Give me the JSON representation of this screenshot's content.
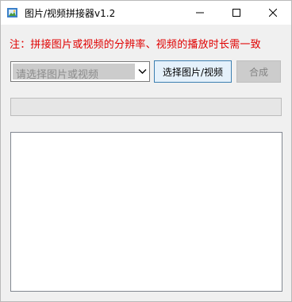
{
  "window": {
    "title": "图片/视频拼接器v1.2",
    "icon": "app-icon"
  },
  "note": "注：拼接图片或视频的分辨率、视频的播放时长需一致",
  "selector": {
    "placeholder": "请选择图片或视频",
    "icon": "chevron-down-icon"
  },
  "buttons": {
    "pick": "选择图片/视频",
    "compose": "合成"
  },
  "progress": {
    "value": 0
  },
  "colors": {
    "note": "#e00000",
    "pick_button_border": "#3c7fb1",
    "pick_button_bg": "#e5f1fb",
    "disabled_bg": "#cccccc"
  }
}
